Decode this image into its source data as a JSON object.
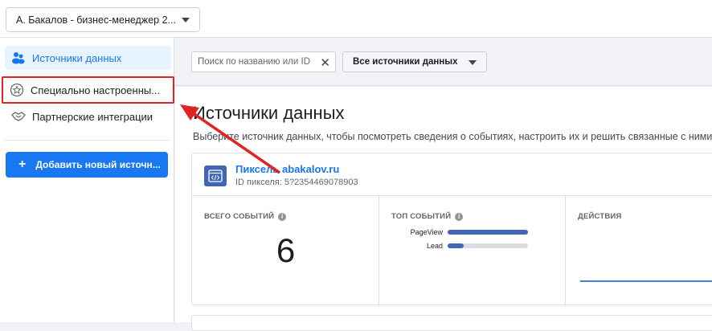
{
  "header": {
    "business_account": "А. Бакалов - бизнес-менеджер 2..."
  },
  "sidebar": {
    "items": [
      {
        "label": "Источники данных",
        "icon": "people-icon",
        "active": true
      },
      {
        "label": "Специально настроенны...",
        "icon": "star-badge-icon",
        "highlighted": true
      },
      {
        "label": "Партнерские интеграции",
        "icon": "handshake-icon"
      }
    ],
    "add_button": "Добавить новый источн..."
  },
  "filters": {
    "search_placeholder": "Поиск по названию или ID",
    "source_dropdown": "Все источники данных"
  },
  "main": {
    "title": "Источники данных",
    "description": "Выберите источник данных, чтобы посмотреть сведения о событиях, настроить их и решить связанные с ними"
  },
  "pixel_card": {
    "name": "Пиксель abakalov.ru",
    "pixel_id": "ID пикселя: 5?2354469078903",
    "total_events_label": "ВСЕГО СОБЫТИЙ",
    "total_events_value": "6",
    "top_events_label": "ТОП СОБЫТИЙ",
    "top_events": [
      {
        "name": "PageView",
        "fraction": 1.0
      },
      {
        "name": "Lead",
        "fraction": 0.2
      }
    ],
    "actions_label": "ДЕЙСТВИЯ"
  },
  "colors": {
    "accent": "#1877f2",
    "highlight": "#e02424",
    "bar": "#4267b2"
  }
}
